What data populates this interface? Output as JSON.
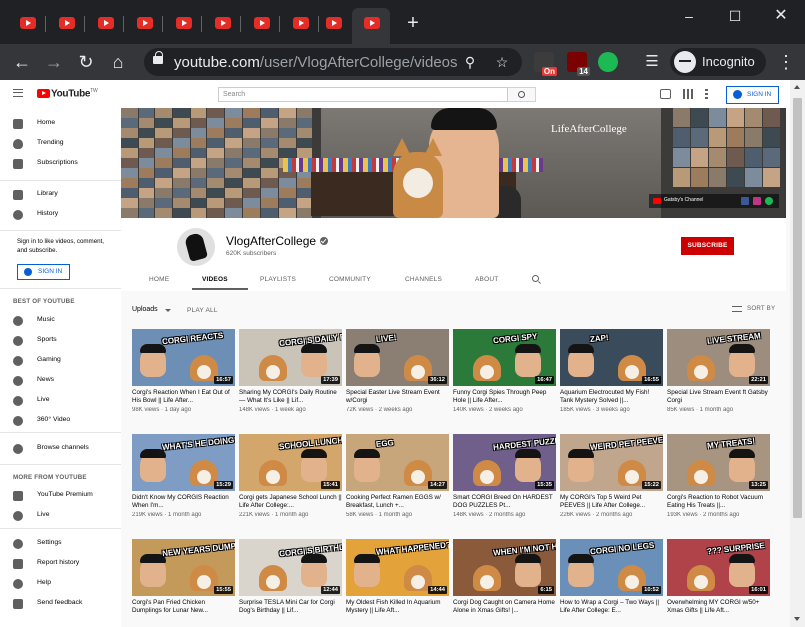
{
  "browser": {
    "tab_count_visible": 10,
    "active_tab_index": 9,
    "new_tab_label": "+",
    "window_controls": [
      "minimize",
      "maximize",
      "close"
    ],
    "url_host": "youtube.com",
    "url_path": "/user/VlogAfterCollege/videos",
    "extensions": [
      {
        "name": "ext-on",
        "badge": "On",
        "color": "#e53935"
      },
      {
        "name": "ext-ublock",
        "badge": "14",
        "color": "#7b0000"
      },
      {
        "name": "ext-green",
        "badge": "",
        "color": "#1db954"
      }
    ],
    "profile_label": "Incognito"
  },
  "masthead": {
    "logo_text": "YouTube",
    "logo_sup": "TW",
    "search_placeholder": "Search",
    "sign_in_label": "SIGN IN"
  },
  "guide": {
    "main": [
      {
        "label": "Home",
        "icon": "home-icon"
      },
      {
        "label": "Trending",
        "icon": "flame-icon"
      },
      {
        "label": "Subscriptions",
        "icon": "subscriptions-icon"
      }
    ],
    "library": [
      {
        "label": "Library",
        "icon": "library-icon"
      },
      {
        "label": "History",
        "icon": "history-icon"
      }
    ],
    "signin_text": "Sign in to like videos, comment, and subscribe.",
    "signin_button": "SIGN IN",
    "best_header": "BEST OF YOUTUBE",
    "best": [
      {
        "label": "Music",
        "icon": "music-icon"
      },
      {
        "label": "Sports",
        "icon": "sports-icon"
      },
      {
        "label": "Gaming",
        "icon": "gaming-icon"
      },
      {
        "label": "News",
        "icon": "news-icon"
      },
      {
        "label": "Live",
        "icon": "live-icon"
      },
      {
        "label": "360° Video",
        "icon": "360-video-icon"
      }
    ],
    "browse_channels": "Browse channels",
    "more_header": "MORE FROM YOUTUBE",
    "more": [
      {
        "label": "YouTube Premium",
        "icon": "youtube-premium-icon"
      },
      {
        "label": "Live",
        "icon": "live-broadcast-icon"
      }
    ],
    "footer": [
      {
        "label": "Settings",
        "icon": "settings-icon"
      },
      {
        "label": "Report history",
        "icon": "flag-icon"
      },
      {
        "label": "Help",
        "icon": "help-icon"
      },
      {
        "label": "Send feedback",
        "icon": "feedback-icon"
      }
    ]
  },
  "banner": {
    "brand": "Life",
    "brand2": "After",
    "brand3": "College",
    "channel_link": "Gatsby's Channel"
  },
  "channel": {
    "name": "VlogAfterCollege",
    "subscribers": "620K subscribers",
    "subscribe_label": "SUBSCRIBE",
    "tabs": [
      "HOME",
      "VIDEOS",
      "PLAYLISTS",
      "COMMUNITY",
      "CHANNELS",
      "ABOUT"
    ],
    "active_tab": "VIDEOS"
  },
  "videos_section": {
    "uploads_label": "Uploads",
    "play_all_label": "PLAY ALL",
    "sort_by_label": "SORT BY"
  },
  "videos": [
    {
      "title": "Corgi's Reaction When I Eat Out of His Bowl || Life After...",
      "meta": "98K views · 1 day ago",
      "duration": "16:57",
      "caption": "CORGI REACTS",
      "bg": "#6d8fb5"
    },
    {
      "title": "Sharing My CORGI's Daily Routine — What It's Like || Lif...",
      "meta": "148K views · 1 week ago",
      "duration": "17:39",
      "caption": "CORGI'S DAILY ROUTINE",
      "bg": "#c9c3b8"
    },
    {
      "title": "Special Easter Live Stream Event w/Corgi",
      "meta": "72K views · 2 weeks ago",
      "duration": "36:12",
      "caption": "LIVE!",
      "bg": "#8b7f73"
    },
    {
      "title": "Funny Corgi Spies Through Peep Hole || Life After...",
      "meta": "140K views · 2 weeks ago",
      "duration": "16:47",
      "caption": "CORGI SPY",
      "bg": "#2c7a3a"
    },
    {
      "title": "Aquarium Electrocuted My Fish! Tank Mystery Solved ||...",
      "meta": "185K views · 3 weeks ago",
      "duration": "16:55",
      "caption": "ZAP!",
      "bg": "#3a4b5c"
    },
    {
      "title": "Special Live Stream Event ft Gatsby Corgi",
      "meta": "85K views · 1 month ago",
      "duration": "22:21",
      "caption": "LIVE STREAM",
      "bg": "#9c8d7e"
    },
    {
      "title": "Didn't Know My CORGIS Reaction When I'm...",
      "meta": "219K views · 1 month ago",
      "duration": "15:29",
      "caption": "WHAT'S HE DOING?",
      "bg": "#7e9cc4"
    },
    {
      "title": "Corgi gets Japanese School Lunch || Life After College:...",
      "meta": "221K views · 1 month ago",
      "duration": "15:41",
      "caption": "SCHOOL LUNCH",
      "bg": "#d3a66b"
    },
    {
      "title": "Cooking Perfect Ramen EGGS w/ Breakfast, Lunch +...",
      "meta": "58K views · 1 month ago",
      "duration": "14:27",
      "caption": "EGG",
      "bg": "#c6a67a"
    },
    {
      "title": "Smart CORGI Breed On HARDEST DOG PUZZLES Pt...",
      "meta": "148K views · 2 months ago",
      "duration": "15:35",
      "caption": "HARDEST PUZZLES",
      "bg": "#6f5f8a"
    },
    {
      "title": "My CORGI's Top 5 Weird Pet PEEVES || Life After College...",
      "meta": "226K views · 2 months ago",
      "duration": "15:22",
      "caption": "WEIRD PET PEEVES",
      "bg": "#bfa68c"
    },
    {
      "title": "Corgi's Reaction to Robot Vacuum Eating His Treats ||...",
      "meta": "193K views · 2 months ago",
      "duration": "13:25",
      "caption": "MY TREATS!",
      "bg": "#a79582"
    },
    {
      "title": "Corgi's Pan Fried Chicken Dumplings for Lunar New...",
      "meta": "",
      "duration": "15:55",
      "caption": "NEW YEARS DUMPLINGS",
      "bg": "#c49a5a"
    },
    {
      "title": "Surprise TESLA Mini Car for Corgi Dog's Birthday || Lif...",
      "meta": "",
      "duration": "12:44",
      "caption": "CORGI'S BIRTHDAY TESLA",
      "bg": "#d9d4cc"
    },
    {
      "title": "My Oldest Fish Killed In Aquarium Mystery || Life Aft...",
      "meta": "",
      "duration": "14:44",
      "caption": "WHAT HAPPENED?",
      "bg": "#e3a23a"
    },
    {
      "title": "Corgi Dog Caught on Camera Home Alone in Xmas Gifts! |...",
      "meta": "",
      "duration": "6:15",
      "caption": "WHEN I'M NOT HOME?",
      "bg": "#8a5a3a"
    },
    {
      "title": "How to Wrap a Corgi – Two Ways || Life After College: E...",
      "meta": "",
      "duration": "10:52",
      "caption": "CORGI NO LEGS",
      "bg": "#6a8fb8"
    },
    {
      "title": "Overwhelming MY CORGI w/50+ Xmas Gifts || Life Aft...",
      "meta": "",
      "duration": "16:01",
      "caption": "??? SURPRISE",
      "bg": "#b0424a"
    }
  ]
}
